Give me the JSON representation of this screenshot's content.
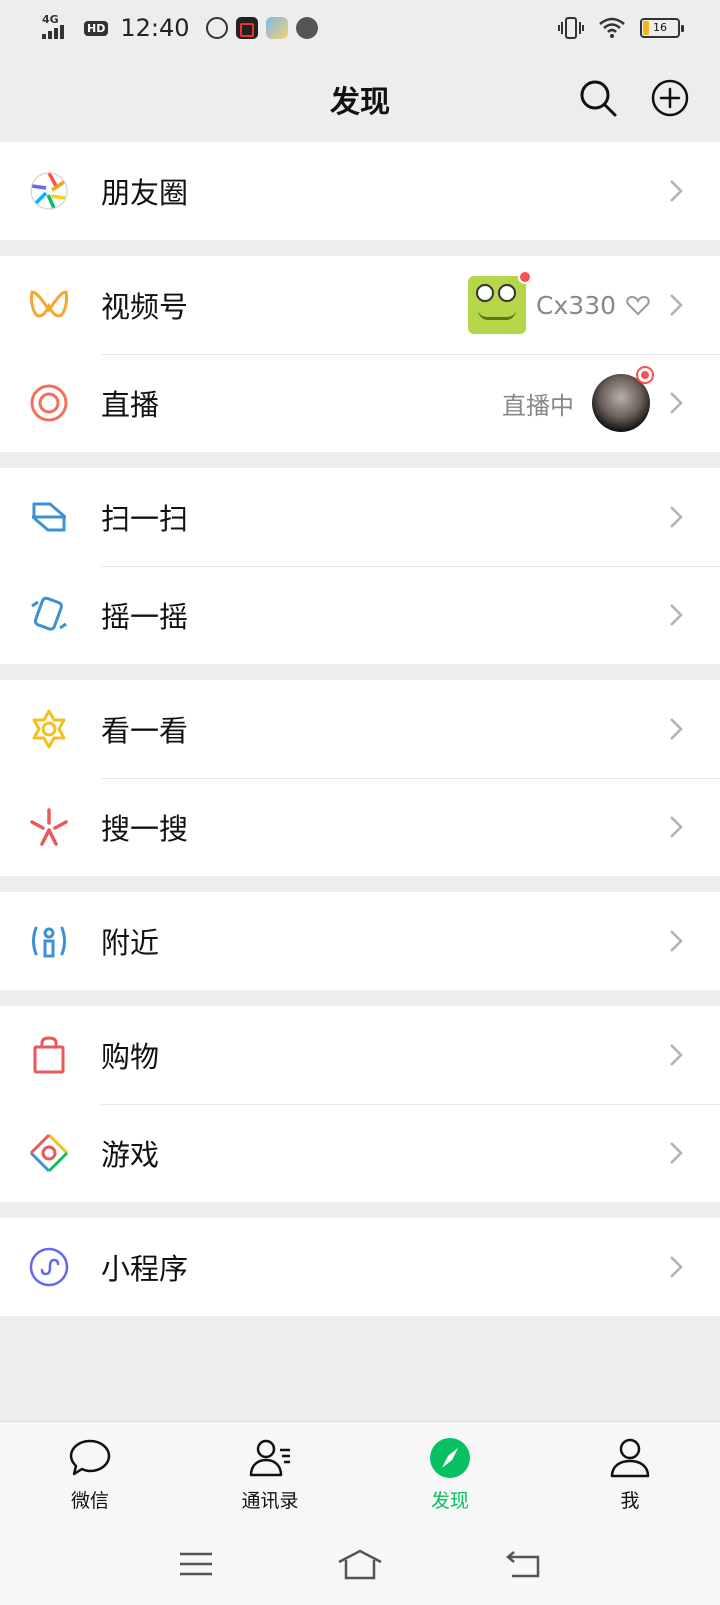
{
  "status_bar": {
    "network": "4G",
    "hd": "HD",
    "time": "12:40",
    "battery": "16",
    "icons": [
      "data-saver-icon",
      "screen-record-icon",
      "app-notification-icon",
      "cat-app-icon",
      "vibrate-icon",
      "wifi-icon",
      "battery-icon"
    ]
  },
  "header": {
    "title": "发现",
    "actions": [
      "search-icon",
      "add-circle-icon"
    ]
  },
  "groups": [
    {
      "items": [
        {
          "label": "朋友圈",
          "icon": "moments-icon"
        }
      ]
    },
    {
      "items": [
        {
          "label": "视频号",
          "icon": "channels-icon",
          "extra_user": "Cx330"
        },
        {
          "label": "直播",
          "icon": "live-icon",
          "extra_text": "直播中"
        }
      ]
    },
    {
      "items": [
        {
          "label": "扫一扫",
          "icon": "scan-icon"
        },
        {
          "label": "摇一摇",
          "icon": "shake-icon"
        }
      ]
    },
    {
      "items": [
        {
          "label": "看一看",
          "icon": "top-stories-icon"
        },
        {
          "label": "搜一搜",
          "icon": "search-star-icon"
        }
      ]
    },
    {
      "items": [
        {
          "label": "附近",
          "icon": "nearby-icon"
        }
      ]
    },
    {
      "items": [
        {
          "label": "购物",
          "icon": "shopping-bag-icon"
        },
        {
          "label": "游戏",
          "icon": "games-icon"
        }
      ]
    },
    {
      "items": [
        {
          "label": "小程序",
          "icon": "mini-program-icon"
        }
      ]
    }
  ],
  "tabs": [
    {
      "label": "微信",
      "icon": "chat-bubble-icon",
      "active": false
    },
    {
      "label": "通讯录",
      "icon": "contacts-icon",
      "active": false
    },
    {
      "label": "发现",
      "icon": "discover-compass-icon",
      "active": true
    },
    {
      "label": "我",
      "icon": "me-person-icon",
      "active": false
    }
  ],
  "colors": {
    "accent": "#07c160",
    "background": "#ededed",
    "badge_red": "#fa5151"
  }
}
